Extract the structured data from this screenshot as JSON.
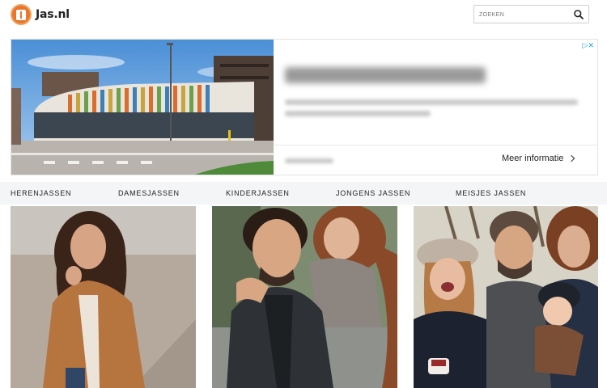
{
  "header": {
    "logo_text": "Jas.nl",
    "search_placeholder": "ZOEKEN"
  },
  "ad": {
    "cta_label": "Meer informatie"
  },
  "nav": {
    "items": [
      {
        "label": "HERENJASSEN"
      },
      {
        "label": "DAMESJASSEN"
      },
      {
        "label": "KINDERJASSEN"
      },
      {
        "label": "JONGENS JASSEN"
      },
      {
        "label": "MEISJES JASSEN"
      }
    ]
  },
  "colors": {
    "brand_orange": "#e8762b",
    "adchoices_blue": "#1ca0e6",
    "nav_background": "#f4f5f7"
  },
  "icons": {
    "search": "search-icon",
    "logo": "coat-logo-icon",
    "adchoices": "adchoices-icon",
    "cta_arrow": "chevron-right-icon"
  }
}
